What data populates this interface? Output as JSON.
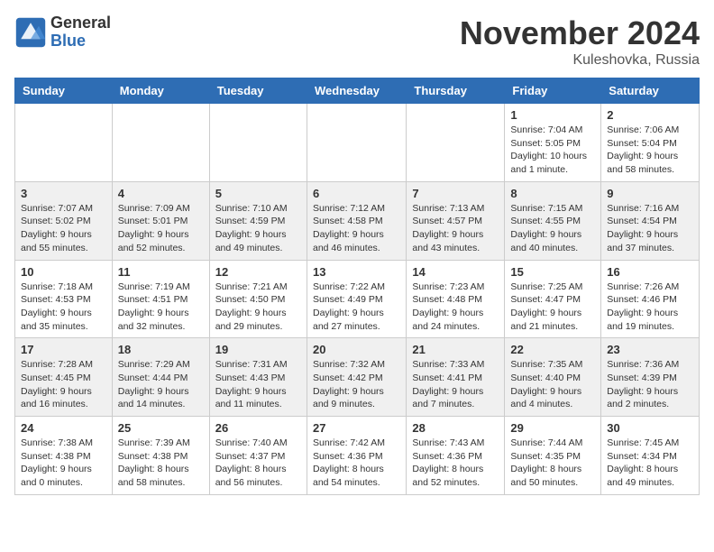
{
  "header": {
    "logo_general": "General",
    "logo_blue": "Blue",
    "month_title": "November 2024",
    "location": "Kuleshovka, Russia"
  },
  "weekdays": [
    "Sunday",
    "Monday",
    "Tuesday",
    "Wednesday",
    "Thursday",
    "Friday",
    "Saturday"
  ],
  "weeks": [
    [
      {
        "day": "",
        "info": ""
      },
      {
        "day": "",
        "info": ""
      },
      {
        "day": "",
        "info": ""
      },
      {
        "day": "",
        "info": ""
      },
      {
        "day": "",
        "info": ""
      },
      {
        "day": "1",
        "info": "Sunrise: 7:04 AM\nSunset: 5:05 PM\nDaylight: 10 hours and 1 minute."
      },
      {
        "day": "2",
        "info": "Sunrise: 7:06 AM\nSunset: 5:04 PM\nDaylight: 9 hours and 58 minutes."
      }
    ],
    [
      {
        "day": "3",
        "info": "Sunrise: 7:07 AM\nSunset: 5:02 PM\nDaylight: 9 hours and 55 minutes."
      },
      {
        "day": "4",
        "info": "Sunrise: 7:09 AM\nSunset: 5:01 PM\nDaylight: 9 hours and 52 minutes."
      },
      {
        "day": "5",
        "info": "Sunrise: 7:10 AM\nSunset: 4:59 PM\nDaylight: 9 hours and 49 minutes."
      },
      {
        "day": "6",
        "info": "Sunrise: 7:12 AM\nSunset: 4:58 PM\nDaylight: 9 hours and 46 minutes."
      },
      {
        "day": "7",
        "info": "Sunrise: 7:13 AM\nSunset: 4:57 PM\nDaylight: 9 hours and 43 minutes."
      },
      {
        "day": "8",
        "info": "Sunrise: 7:15 AM\nSunset: 4:55 PM\nDaylight: 9 hours and 40 minutes."
      },
      {
        "day": "9",
        "info": "Sunrise: 7:16 AM\nSunset: 4:54 PM\nDaylight: 9 hours and 37 minutes."
      }
    ],
    [
      {
        "day": "10",
        "info": "Sunrise: 7:18 AM\nSunset: 4:53 PM\nDaylight: 9 hours and 35 minutes."
      },
      {
        "day": "11",
        "info": "Sunrise: 7:19 AM\nSunset: 4:51 PM\nDaylight: 9 hours and 32 minutes."
      },
      {
        "day": "12",
        "info": "Sunrise: 7:21 AM\nSunset: 4:50 PM\nDaylight: 9 hours and 29 minutes."
      },
      {
        "day": "13",
        "info": "Sunrise: 7:22 AM\nSunset: 4:49 PM\nDaylight: 9 hours and 27 minutes."
      },
      {
        "day": "14",
        "info": "Sunrise: 7:23 AM\nSunset: 4:48 PM\nDaylight: 9 hours and 24 minutes."
      },
      {
        "day": "15",
        "info": "Sunrise: 7:25 AM\nSunset: 4:47 PM\nDaylight: 9 hours and 21 minutes."
      },
      {
        "day": "16",
        "info": "Sunrise: 7:26 AM\nSunset: 4:46 PM\nDaylight: 9 hours and 19 minutes."
      }
    ],
    [
      {
        "day": "17",
        "info": "Sunrise: 7:28 AM\nSunset: 4:45 PM\nDaylight: 9 hours and 16 minutes."
      },
      {
        "day": "18",
        "info": "Sunrise: 7:29 AM\nSunset: 4:44 PM\nDaylight: 9 hours and 14 minutes."
      },
      {
        "day": "19",
        "info": "Sunrise: 7:31 AM\nSunset: 4:43 PM\nDaylight: 9 hours and 11 minutes."
      },
      {
        "day": "20",
        "info": "Sunrise: 7:32 AM\nSunset: 4:42 PM\nDaylight: 9 hours and 9 minutes."
      },
      {
        "day": "21",
        "info": "Sunrise: 7:33 AM\nSunset: 4:41 PM\nDaylight: 9 hours and 7 minutes."
      },
      {
        "day": "22",
        "info": "Sunrise: 7:35 AM\nSunset: 4:40 PM\nDaylight: 9 hours and 4 minutes."
      },
      {
        "day": "23",
        "info": "Sunrise: 7:36 AM\nSunset: 4:39 PM\nDaylight: 9 hours and 2 minutes."
      }
    ],
    [
      {
        "day": "24",
        "info": "Sunrise: 7:38 AM\nSunset: 4:38 PM\nDaylight: 9 hours and 0 minutes."
      },
      {
        "day": "25",
        "info": "Sunrise: 7:39 AM\nSunset: 4:38 PM\nDaylight: 8 hours and 58 minutes."
      },
      {
        "day": "26",
        "info": "Sunrise: 7:40 AM\nSunset: 4:37 PM\nDaylight: 8 hours and 56 minutes."
      },
      {
        "day": "27",
        "info": "Sunrise: 7:42 AM\nSunset: 4:36 PM\nDaylight: 8 hours and 54 minutes."
      },
      {
        "day": "28",
        "info": "Sunrise: 7:43 AM\nSunset: 4:36 PM\nDaylight: 8 hours and 52 minutes."
      },
      {
        "day": "29",
        "info": "Sunrise: 7:44 AM\nSunset: 4:35 PM\nDaylight: 8 hours and 50 minutes."
      },
      {
        "day": "30",
        "info": "Sunrise: 7:45 AM\nSunset: 4:34 PM\nDaylight: 8 hours and 49 minutes."
      }
    ]
  ]
}
